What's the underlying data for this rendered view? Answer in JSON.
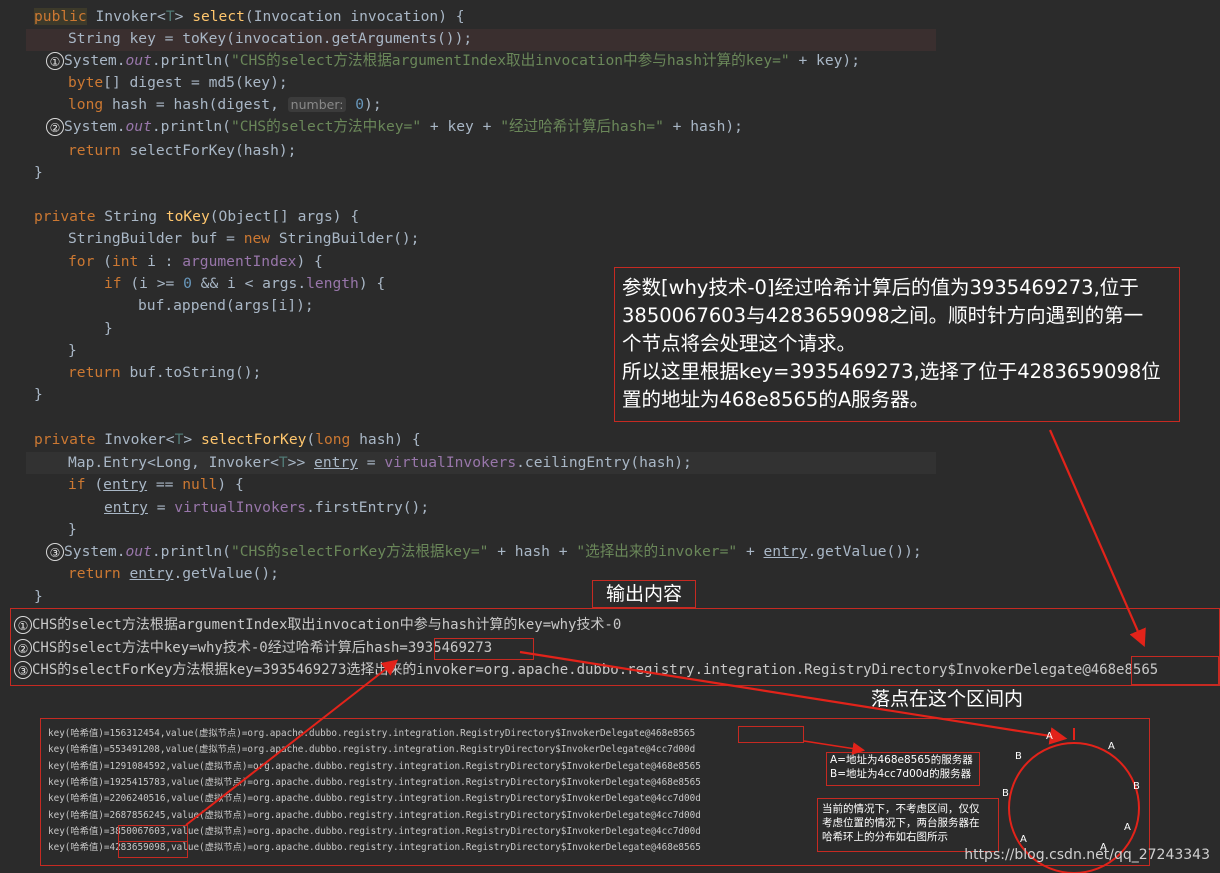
{
  "code": {
    "l1": {
      "kw": "public",
      "type_a": "Invoker<",
      "tp": "T",
      "type_b": "> ",
      "fn": "select",
      "rest": "(Invocation invocation) {"
    },
    "l2": {
      "a": "String key = toKey(invocation.getArguments());"
    },
    "l3": {
      "num": "①",
      "a": "System.",
      "b": "out",
      "c": ".println(",
      "s": "\"CHS的select方法根据argumentIndex取出invocation中参与hash计算的key=\"",
      "d": " + key);"
    },
    "l4": {
      "kw": "byte",
      "a": "[] digest = md5(key);"
    },
    "l5": {
      "kw": "long",
      "a": " hash = hash(digest, ",
      "hint": "number:",
      "n": "0",
      "b": ");"
    },
    "l6": {
      "num": "②",
      "a": "System.",
      "b": "out",
      "c": ".println(",
      "s1": "\"CHS的select方法中key=\"",
      "d": " + key + ",
      "s2": "\"经过哈希计算后hash=\"",
      "e": " + hash);"
    },
    "l7": {
      "kw": "return",
      "a": " selectForKey(hash);"
    },
    "l8": {
      "a": "}"
    },
    "l10": {
      "kw": "private",
      "a": " String ",
      "fn": "toKey",
      "b": "(Object[] args) {"
    },
    "l11": {
      "a": "StringBuilder buf = ",
      "kw": "new",
      "b": " StringBuilder();"
    },
    "l12": {
      "kw": "for",
      "a": " (",
      "kw2": "int",
      "b": " i : ",
      "f": "argumentIndex",
      "c": ") {"
    },
    "l13": {
      "kw": "if",
      "a": " (i >= ",
      "n": "0",
      "b": " && i < args.",
      "f": "length",
      "c": ") {"
    },
    "l14": {
      "a": "buf.append(args[i]);"
    },
    "l15": {
      "a": "}"
    },
    "l16": {
      "a": "}"
    },
    "l17": {
      "kw": "return",
      "a": " buf.toString();"
    },
    "l18": {
      "a": "}"
    },
    "l20": {
      "kw": "private",
      "a": " Invoker<",
      "tp": "T",
      "b": "> ",
      "fn": "selectForKey",
      "c": "(",
      "kw2": "long",
      "d": " hash) {"
    },
    "l21": {
      "a": "Map.Entry<Long, Invoker<",
      "tp": "T",
      "b": ">> ",
      "v": "entry",
      "c": " = ",
      "f": "virtualInvokers",
      "d": ".ceilingEntry(hash);"
    },
    "l22": {
      "kw": "if",
      "a": " (",
      "v": "entry",
      "b": " == ",
      "kw2": "null",
      "c": ") {"
    },
    "l23": {
      "v": "entry",
      "a": " = ",
      "f": "virtualInvokers",
      "b": ".firstEntry();"
    },
    "l24": {
      "a": "}"
    },
    "l25": {
      "num": "③",
      "a": "System.",
      "b": "out",
      "c": ".println(",
      "s1": "\"CHS的selectForKey方法根据key=\"",
      "d": " + hash + ",
      "s2": "\"选择出来的invoker=\"",
      "e": " + ",
      "v": "entry",
      "f": ".getValue());"
    },
    "l26": {
      "kw": "return",
      "a": " ",
      "v": "entry",
      "b": ".getValue();"
    },
    "l27": {
      "a": "}"
    }
  },
  "callout": {
    "line1": "参数[why技术-0]经过哈希计算后的值为3935469273,位于",
    "line2": "3850067603与4283659098之间。顺时针方向遇到的第一",
    "line3": "个节点将会处理这个请求。",
    "line4": "所以这里根据key=3935469273,选择了位于4283659098位",
    "line5": "置的地址为468e8565的A服务器。"
  },
  "output": {
    "title": "输出内容",
    "n1": "①",
    "t1": "CHS的select方法根据argumentIndex取出invocation中参与hash计算的key=why技术-0",
    "n2": "②",
    "t2a": "CHS的select方法中key=why技术-0经过哈希计算后hash=",
    "t2b": "3935469273",
    "n3": "③",
    "t3a": "CHS的selectForKey方法根据key=3935469273选择出来的invoker=org.apache.dubbo.registry.integration.RegistryDirectory$InvokerDelegate",
    "t3b": "@468e8565"
  },
  "interval_label": "落点在这个区间内",
  "hash_table": {
    "rows": [
      {
        "pre": "key(哈希值)=",
        "h": "156312454",
        "mid": ",value(虚拟节点)=org.apache.dubbo.registry.integration.RegistryDirectory$InvokerDelegate",
        "addr": "@468e8565"
      },
      {
        "pre": "key(哈希值)=",
        "h": "553491208",
        "mid": ",value(虚拟节点)=org.apache.dubbo.registry.integration.RegistryDirectory$InvokerDelegate",
        "addr": "@4cc7d00d"
      },
      {
        "pre": "key(哈希值)=",
        "h": "1291084592",
        "mid": ",value(虚拟节点)=org.apache.dubbo.registry.integration.RegistryDirectory$InvokerDelegate",
        "addr": "@468e8565"
      },
      {
        "pre": "key(哈希值)=",
        "h": "1925415783",
        "mid": ",value(虚拟节点)=org.apache.dubbo.registry.integration.RegistryDirectory$InvokerDelegate",
        "addr": "@468e8565"
      },
      {
        "pre": "key(哈希值)=",
        "h": "2206240516",
        "mid": ",value(虚拟节点)=org.apache.dubbo.registry.integration.RegistryDirectory$InvokerDelegate",
        "addr": "@4cc7d00d"
      },
      {
        "pre": "key(哈希值)=",
        "h": "2687856245",
        "mid": ",value(虚拟节点)=org.apache.dubbo.registry.integration.RegistryDirectory$InvokerDelegate",
        "addr": "@4cc7d00d"
      },
      {
        "pre": "key(哈希值)=",
        "h": "3850067603",
        "mid": ",value(虚拟节点)=org.apache.dubbo.registry.integration.RegistryDirectory$InvokerDelegate",
        "addr": "@4cc7d00d"
      },
      {
        "pre": "key(哈希值)=",
        "h": "4283659098",
        "mid": ",value(虚拟节点)=org.apache.dubbo.registry.integration.RegistryDirectory$InvokerDelegate",
        "addr": "@468e8565"
      }
    ]
  },
  "legend": {
    "a": "A=地址为468e8565的服务器",
    "b": "B=地址为4cc7d00d的服务器"
  },
  "note": {
    "l1": "当前的情况下，不考虑区间，仅仅",
    "l2": "考虑位置的情况下，两台服务器在",
    "l3": "哈希环上的分布如右图所示"
  },
  "ring": {
    "labels": [
      "A",
      "A",
      "B",
      "B",
      "B",
      "A",
      "A",
      "A"
    ]
  },
  "watermark": "https://blog.csdn.net/qq_27243343",
  "colors": {
    "accent_red": "#e2231a",
    "box_red": "#c62a22"
  }
}
